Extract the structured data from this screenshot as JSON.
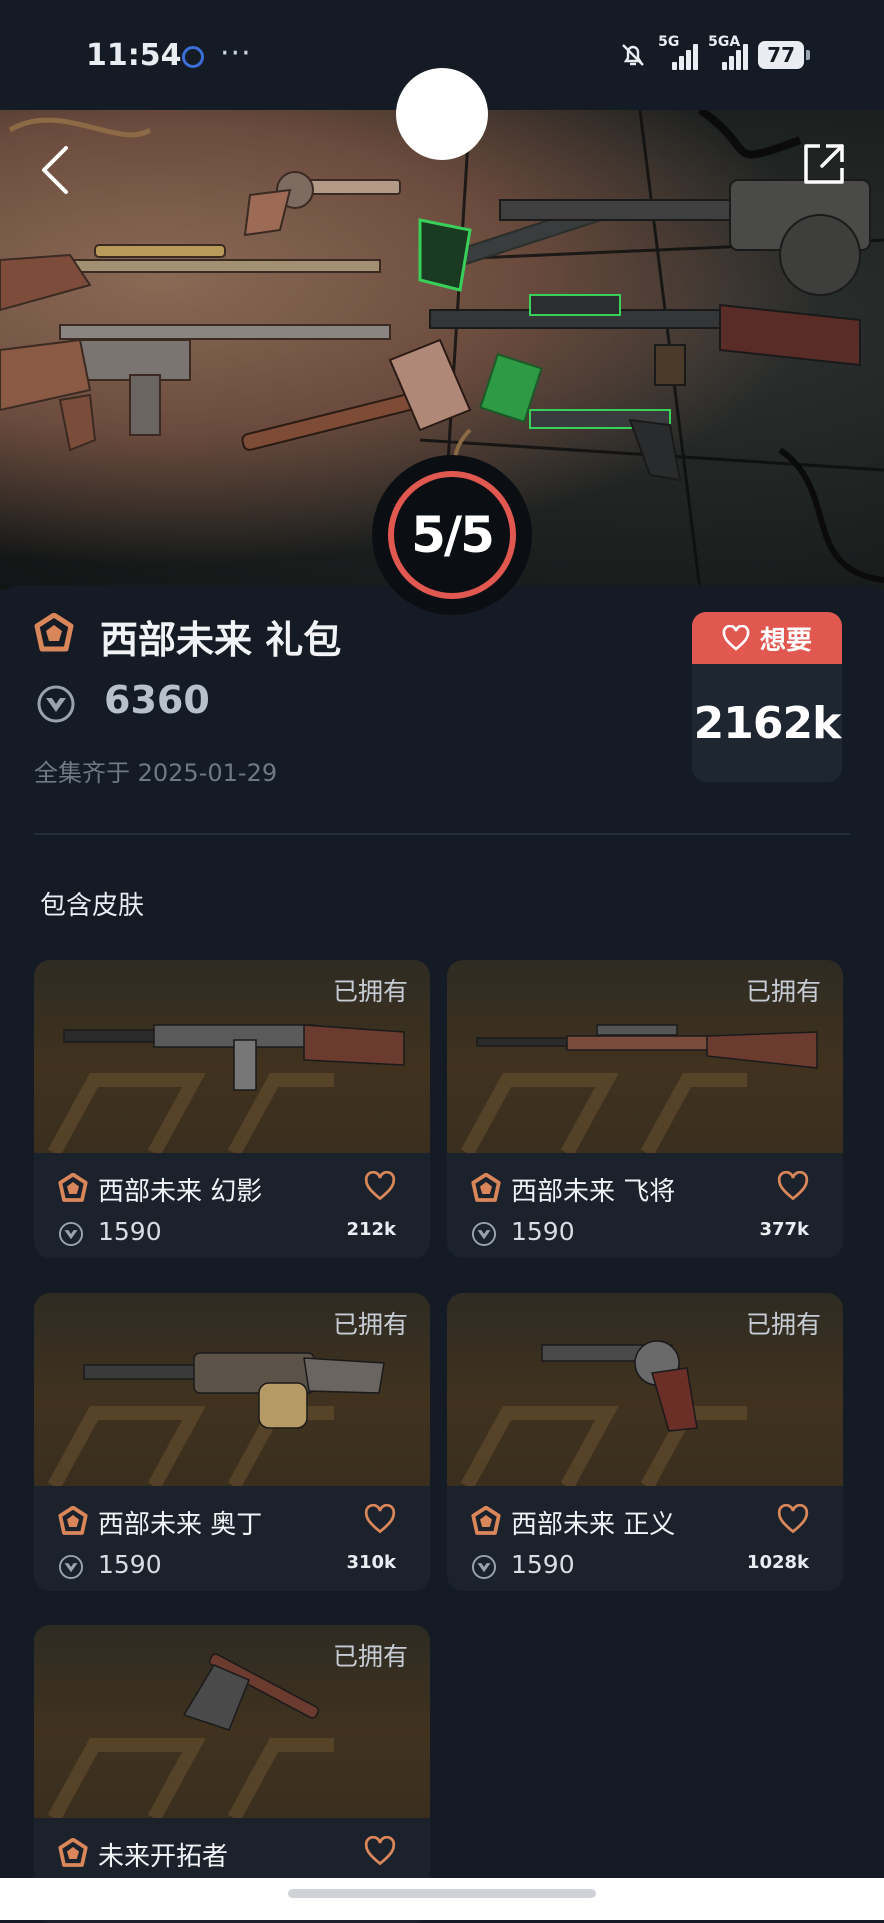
{
  "status_bar": {
    "time": "11:54",
    "dots": "···",
    "net1": "5G",
    "net2": "5GA",
    "battery": "77"
  },
  "hero": {
    "progress": "5/5"
  },
  "bundle": {
    "title": "西部未来 礼包",
    "price": "6360",
    "complete_date": "全集齐于 2025-01-29",
    "want_label": "想要",
    "want_count": "2162k"
  },
  "section": {
    "title": "包含皮肤"
  },
  "skins": [
    {
      "owned": "已拥有",
      "name": "西部未来 幻影",
      "price": "1590",
      "wants": "212k",
      "weapon": "rifle"
    },
    {
      "owned": "已拥有",
      "name": "西部未来 飞将",
      "price": "1590",
      "wants": "377k",
      "weapon": "sniper"
    },
    {
      "owned": "已拥有",
      "name": "西部未来 奥丁",
      "price": "1590",
      "wants": "310k",
      "weapon": "machine-gun"
    },
    {
      "owned": "已拥有",
      "name": "西部未来 正义",
      "price": "1590",
      "wants": "1028k",
      "weapon": "revolver"
    },
    {
      "owned": "已拥有",
      "name": "未来开拓者",
      "price": "",
      "wants": "",
      "weapon": "axe"
    }
  ],
  "colors": {
    "accent": "#e0584f",
    "background": "#141b24",
    "card": "#1b222c",
    "tier": "#d9875a"
  }
}
